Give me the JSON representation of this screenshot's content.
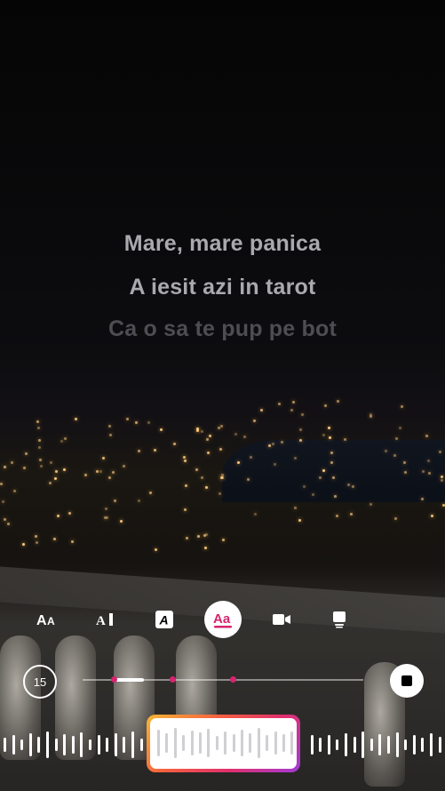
{
  "lyrics": {
    "line1": "Mare, mare panica",
    "line2": "A iesit azi in tarot",
    "line3": "Ca o sa te pup pe bot"
  },
  "toolbar": {
    "styles": [
      {
        "icon": "text-size-style-icon",
        "label": "AA"
      },
      {
        "icon": "text-cursor-style-icon",
        "label": "A"
      },
      {
        "icon": "text-boxed-style-icon",
        "label": "A"
      },
      {
        "icon": "text-underline-style-icon",
        "label": "Aa",
        "selected": true
      },
      {
        "icon": "video-camera-icon"
      },
      {
        "icon": "card-style-icon"
      }
    ]
  },
  "playback": {
    "duration": "15",
    "progress_fraction": 0.11
  },
  "colors": {
    "accent": "#d6246e",
    "gradient": [
      "#f7b733",
      "#f56040",
      "#e1306c",
      "#a13ad9"
    ]
  }
}
